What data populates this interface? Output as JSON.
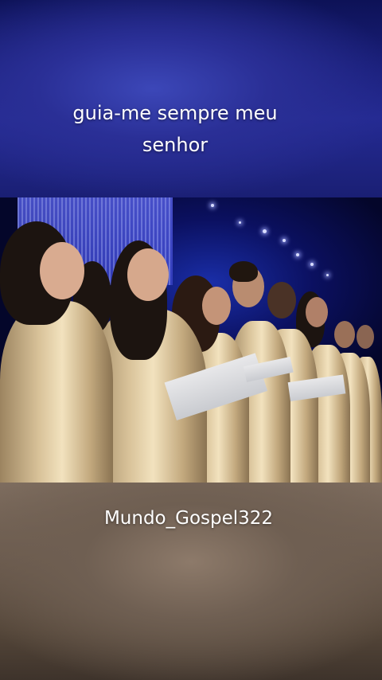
{
  "caption": {
    "line1": "guia-me sempre meu",
    "line2": "senhor"
  },
  "video": {
    "scene": "choir-performance"
  },
  "watermark": {
    "handle": "Mundo_Gospel322"
  },
  "colors": {
    "top_band": "#242a92",
    "bottom_band": "#6f5f52",
    "text": "#ffffff",
    "robe_gold": "#e6d3aa"
  }
}
